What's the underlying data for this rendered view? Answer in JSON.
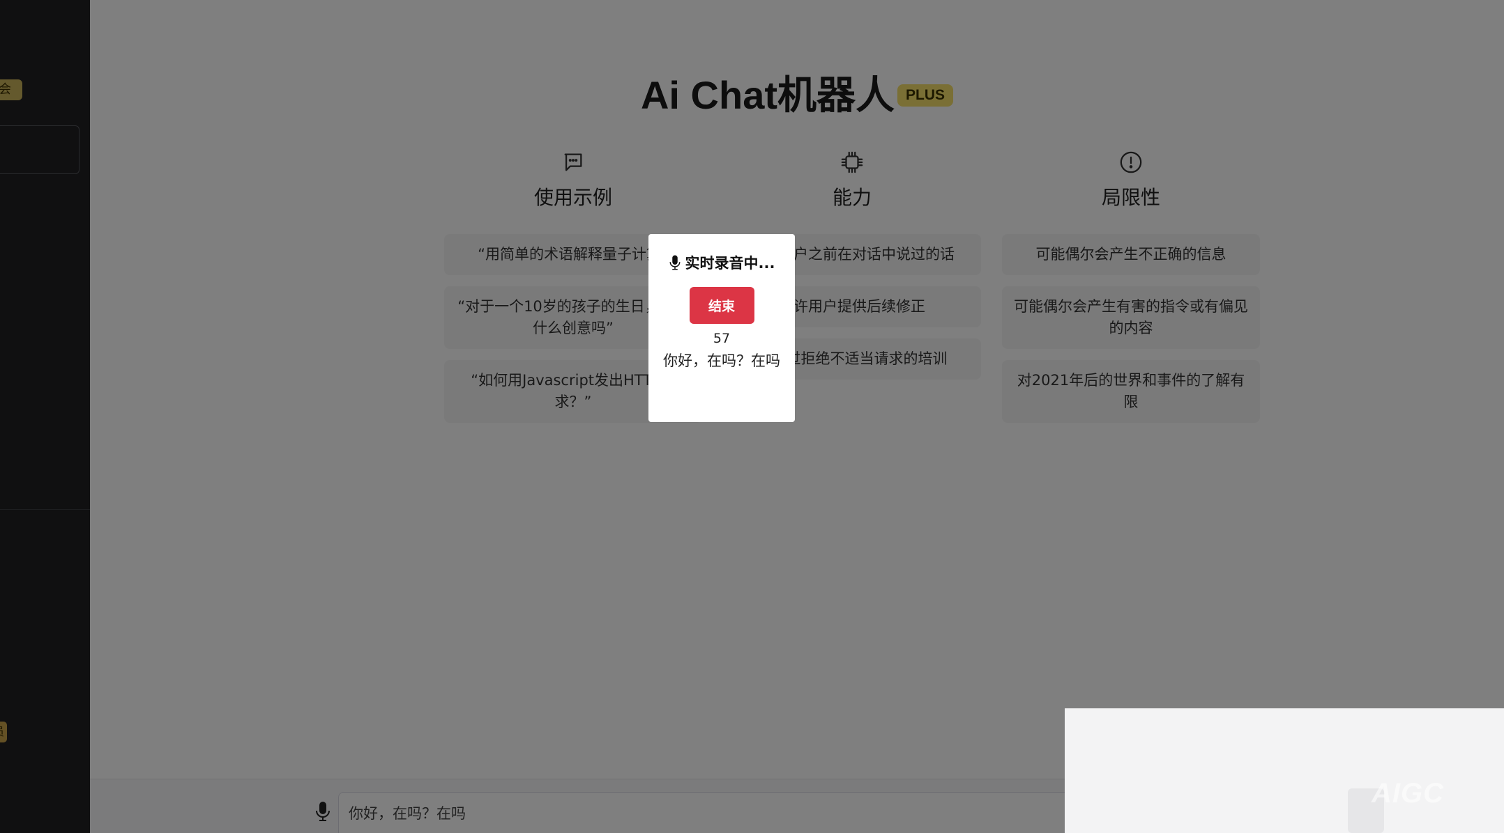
{
  "sidebar": {
    "badge_top": "会员",
    "badge_bottom": "员"
  },
  "header": {
    "title": "Ai Chat机器人",
    "badge": "PLUS"
  },
  "columns": [
    {
      "icon": "chat-bubble-icon",
      "heading": "使用示例",
      "items": [
        "“用简单的术语解释量子计算”",
        "“对于一个10岁的孩子的生日，你有什么创意吗”",
        "“如何用Javascript发出HTTP请求？”"
      ]
    },
    {
      "icon": "chip-icon",
      "heading": "能力",
      "items": [
        "记住用户之前在对话中说过的话",
        "允许用户提供后续修正",
        "接受过拒绝不适当请求的培训"
      ]
    },
    {
      "icon": "alert-circle-icon",
      "heading": "局限性",
      "items": [
        "可能偶尔会产生不正确的信息",
        "可能偶尔会产生有害的指令或有偏见的内容",
        "对2021年后的世界和事件的了解有限"
      ]
    }
  ],
  "input": {
    "value": "你好，在吗？在吗"
  },
  "modal": {
    "title": "实时录音中...",
    "end_label": "结束",
    "count": "57",
    "transcript": "你好，在吗？在吗"
  },
  "watermark": "AIGC"
}
